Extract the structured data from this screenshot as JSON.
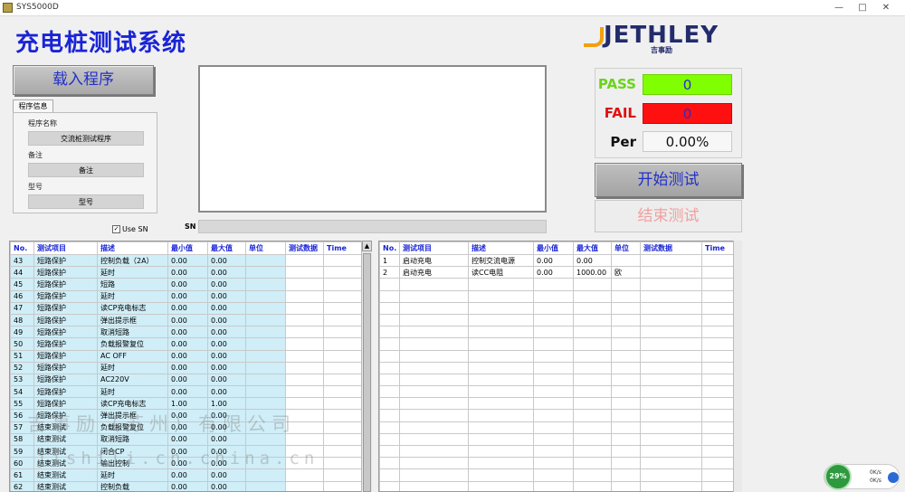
{
  "window": {
    "title": "SYS5000D"
  },
  "app": {
    "title": "充电桩测试系统"
  },
  "logo": {
    "brand": "JETHLEY",
    "sub": "吉事励"
  },
  "buttons": {
    "load": "载入程序",
    "start": "开始测试",
    "stop": "结束测试"
  },
  "info_tab": {
    "tab_label": "程序信息",
    "fields": [
      {
        "label": "程序名称",
        "value": "交流桩测试程序"
      },
      {
        "label": "备注",
        "value": "备注"
      },
      {
        "label": "型号",
        "value": "型号"
      }
    ]
  },
  "use_sn": {
    "label": "Use SN",
    "checked": true
  },
  "sn": {
    "label": "SN",
    "value": ""
  },
  "stats": {
    "pass_label": "PASS",
    "pass_value": "0",
    "pass_color": "#80ff00",
    "fail_label": "FAIL",
    "fail_value": "0",
    "fail_color": "#ff1010",
    "per_label": "Per",
    "per_value": "0.00%"
  },
  "left_table": {
    "columns": [
      "No.",
      "测试项目",
      "描述",
      "最小值",
      "最大值",
      "单位",
      "测试数据",
      "Time"
    ],
    "rows": [
      [
        "43",
        "短路保护",
        "控制负载（2A）",
        "0.00",
        "0.00"
      ],
      [
        "44",
        "短路保护",
        "延时",
        "0.00",
        "0.00"
      ],
      [
        "45",
        "短路保护",
        "短路",
        "0.00",
        "0.00"
      ],
      [
        "46",
        "短路保护",
        "延时",
        "0.00",
        "0.00"
      ],
      [
        "47",
        "短路保护",
        "读CP充电标志",
        "0.00",
        "0.00"
      ],
      [
        "48",
        "短路保护",
        "弹出提示框",
        "0.00",
        "0.00"
      ],
      [
        "49",
        "短路保护",
        "取消短路",
        "0.00",
        "0.00"
      ],
      [
        "50",
        "短路保护",
        "负载报警复位",
        "0.00",
        "0.00"
      ],
      [
        "51",
        "短路保护",
        "AC OFF",
        "0.00",
        "0.00"
      ],
      [
        "52",
        "短路保护",
        "延时",
        "0.00",
        "0.00"
      ],
      [
        "53",
        "短路保护",
        "AC220V",
        "0.00",
        "0.00"
      ],
      [
        "54",
        "短路保护",
        "延时",
        "0.00",
        "0.00"
      ],
      [
        "55",
        "短路保护",
        "读CP充电标志",
        "1.00",
        "1.00"
      ],
      [
        "56",
        "短路保护",
        "弹出提示框",
        "0.00",
        "0.00"
      ],
      [
        "57",
        "结束测试",
        "负载报警复位",
        "0.00",
        "0.00"
      ],
      [
        "58",
        "结束测试",
        "取消短路",
        "0.00",
        "0.00"
      ],
      [
        "59",
        "结束测试",
        "闭合CP",
        "0.00",
        "0.00"
      ],
      [
        "60",
        "结束测试",
        "输出控制",
        "0.00",
        "0.00"
      ],
      [
        "61",
        "结束测试",
        "延时",
        "0.00",
        "0.00"
      ],
      [
        "62",
        "结束测试",
        "控制负载",
        "0.00",
        "0.00"
      ]
    ]
  },
  "right_table": {
    "columns": [
      "No.",
      "测试项目",
      "描述",
      "最小值",
      "最大值",
      "单位",
      "测试数据",
      "Time"
    ],
    "rows": [
      [
        "1",
        "启动充电",
        "控制交流电源",
        "0.00",
        "0.00",
        ""
      ],
      [
        "2",
        "启动充电",
        "读CC电阻",
        "0.00",
        "1000.00",
        "欧"
      ]
    ]
  },
  "watermark": {
    "line1": "吉事励（苏州）有限公司",
    "line2": "jishili.cn.china.cn"
  },
  "net_widget": {
    "percent": "29%",
    "up": "0K/s",
    "down": "0K/s"
  }
}
